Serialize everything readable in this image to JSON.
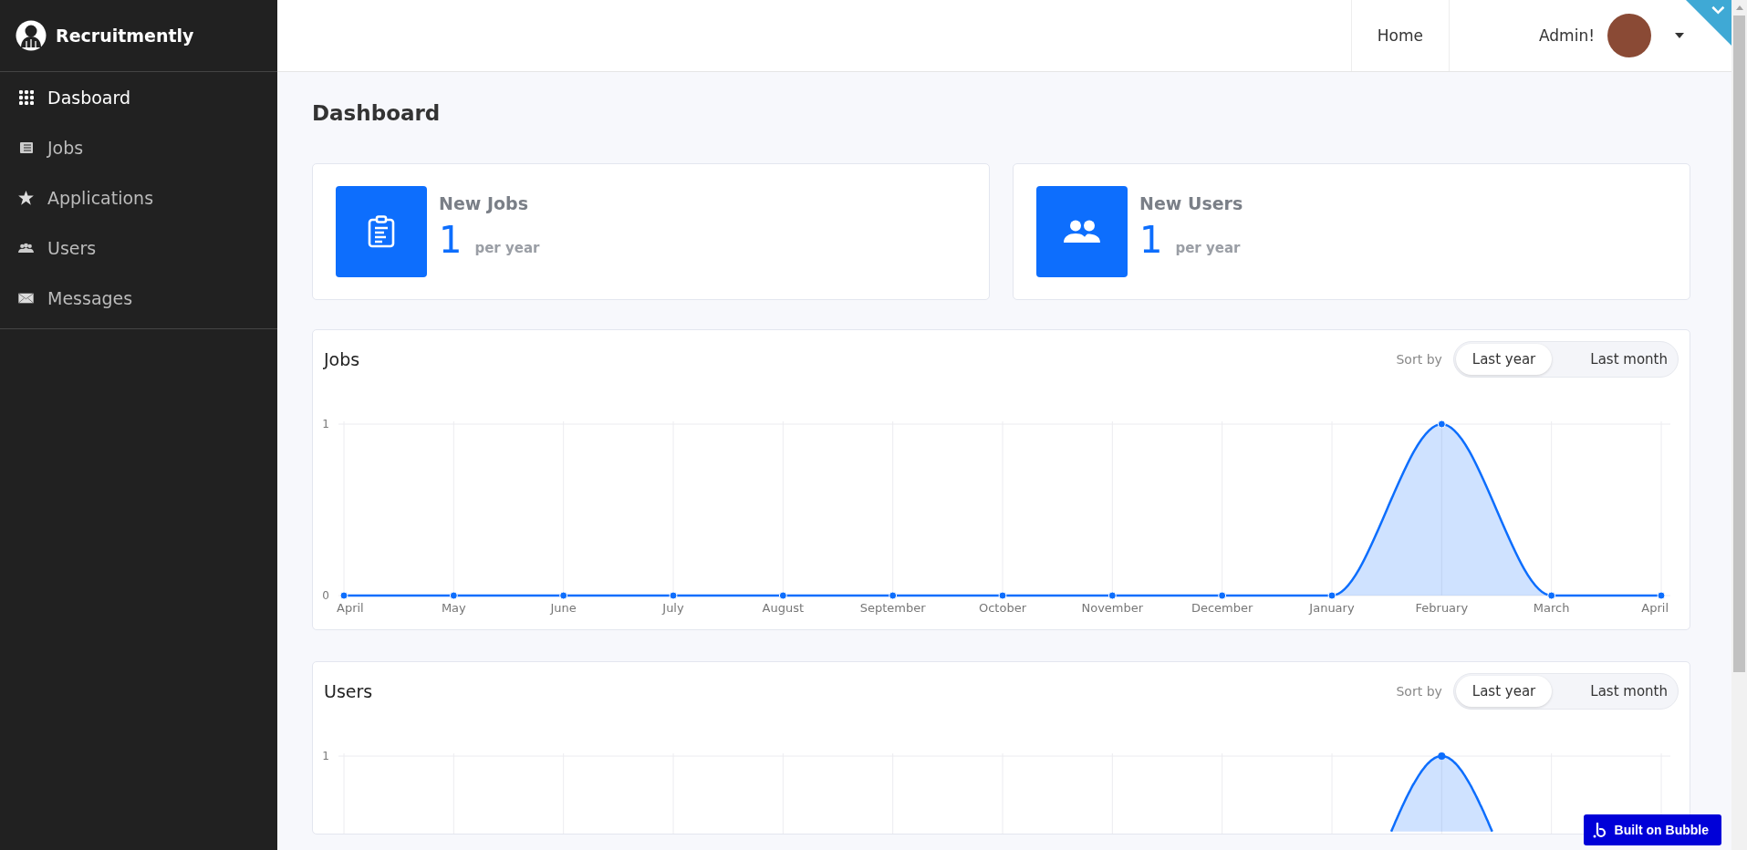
{
  "brand": {
    "name": "Recruitmently"
  },
  "sidebar": {
    "items": [
      {
        "label": "Dasboard",
        "selected": true
      },
      {
        "label": "Jobs",
        "selected": false
      },
      {
        "label": "Applications",
        "selected": false
      },
      {
        "label": "Users",
        "selected": false
      },
      {
        "label": "Messages",
        "selected": false
      }
    ]
  },
  "header": {
    "nav": "Home",
    "user": "Admin!"
  },
  "page_title": "Dashboard",
  "stats": [
    {
      "title": "New Jobs",
      "value": "1",
      "unit": "per year"
    },
    {
      "title": "New Users",
      "value": "1",
      "unit": "per year"
    }
  ],
  "charts": [
    {
      "title": "Jobs",
      "sort_label": "Sort by",
      "sort_options": [
        {
          "label": "Last year",
          "selected": true
        },
        {
          "label": "Last month",
          "selected": false
        }
      ],
      "chart_data": {
        "type": "area",
        "categories": [
          "April",
          "May",
          "June",
          "July",
          "August",
          "September",
          "October",
          "November",
          "December",
          "January",
          "February",
          "March",
          "April"
        ],
        "series": [
          {
            "color": "#0d6efd",
            "values": [
              0,
              0,
              0,
              0,
              0,
              0,
              0,
              0,
              0,
              0,
              1,
              0,
              0
            ]
          }
        ],
        "yticks": [
          0,
          1
        ],
        "ylim": [
          0,
          1
        ],
        "grid": true
      }
    },
    {
      "title": "Users",
      "sort_label": "Sort by",
      "sort_options": [
        {
          "label": "Last year",
          "selected": true
        },
        {
          "label": "Last month",
          "selected": false
        }
      ],
      "y_tick": "1"
    }
  ],
  "badge": "Built on Bubble"
}
